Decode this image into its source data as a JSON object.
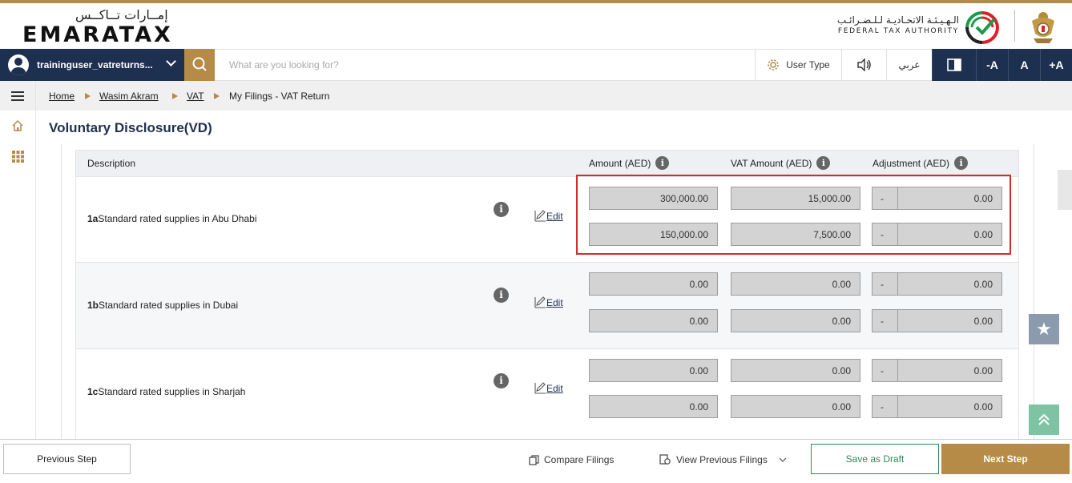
{
  "header": {
    "logo_ar": "إمــارات تــاكــس",
    "logo_en": "EMARATAX",
    "authority_ar": "الـهـيـئـة الاتحـاديـة لـلـضـرائـب",
    "authority_en": "FEDERAL TAX AUTHORITY"
  },
  "nav": {
    "username": "traininguser_vatreturns...",
    "search_placeholder": "What are you looking for?",
    "user_type": "User Type",
    "arabic": "عربي",
    "font_minus": "-A",
    "font_normal": "A",
    "font_plus": "+A"
  },
  "breadcrumb": [
    "Home",
    "Wasim Akram",
    "VAT",
    "My Filings - VAT Return"
  ],
  "page_title": "Voluntary Disclosure(VD)",
  "table": {
    "headers": {
      "description": "Description",
      "amount": "Amount (AED)",
      "vat_amount": "VAT Amount (AED)",
      "adjustment": "Adjustment (AED)"
    },
    "edit_label": "Edit",
    "rows": [
      {
        "code": "1a",
        "label": "Standard rated supplies in Abu Dhabi",
        "lines": [
          {
            "amount": "300,000.00",
            "vat": "15,000.00",
            "sign": "-",
            "adjustment": "0.00"
          },
          {
            "amount": "150,000.00",
            "vat": "7,500.00",
            "sign": "-",
            "adjustment": "0.00"
          }
        ]
      },
      {
        "code": "1b",
        "label": "Standard rated supplies in Dubai",
        "lines": [
          {
            "amount": "0.00",
            "vat": "0.00",
            "sign": "-",
            "adjustment": "0.00"
          },
          {
            "amount": "0.00",
            "vat": "0.00",
            "sign": "-",
            "adjustment": "0.00"
          }
        ]
      },
      {
        "code": "1c",
        "label": "Standard rated supplies in Sharjah",
        "lines": [
          {
            "amount": "0.00",
            "vat": "0.00",
            "sign": "-",
            "adjustment": "0.00"
          },
          {
            "amount": "0.00",
            "vat": "0.00",
            "sign": "-",
            "adjustment": "0.00"
          }
        ]
      }
    ]
  },
  "footer": {
    "previous": "Previous Step",
    "compare": "Compare Filings",
    "view_previous": "View Previous Filings",
    "save_draft": "Save as Draft",
    "next": "Next Step"
  },
  "colors": {
    "navy": "#1e3050",
    "gold": "#b68a47",
    "highlight": "#d52b2b",
    "green": "#2e8a57"
  }
}
